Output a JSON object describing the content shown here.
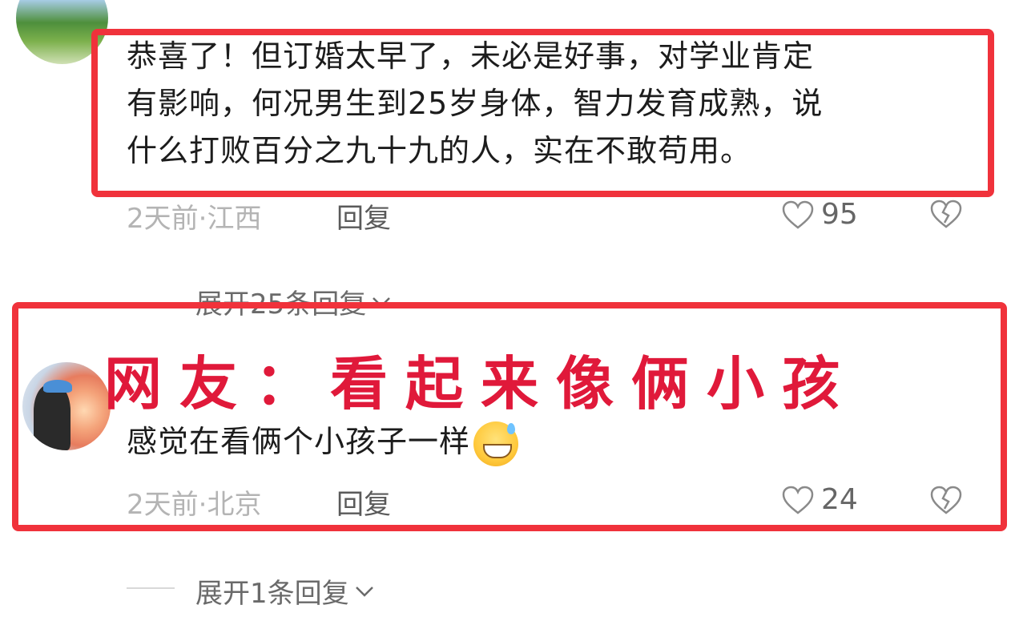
{
  "comment1": {
    "text": "恭喜了！但订婚太早了，未必是好事，对学业肯定有影响，何况男生到25岁身体，智力发育成熟，说什么打败百分之九十九的人，实在不敢苟用。",
    "lines": [
      "恭喜了！但订婚太早了，未必是好事，对学业肯定",
      "有影响，何况男生到25岁身体，智力发育成熟，说",
      "什么打败百分之九十九的人，实在不敢苟用。"
    ],
    "meta": "2天前·江西",
    "reply_label": "回复",
    "likes": "95",
    "expand_label": "展开25条回复"
  },
  "caption": "网友：看起来像俩小孩",
  "comment2": {
    "text": "感觉在看俩个小孩子一样",
    "meta": "2天前·北京",
    "reply_label": "回复",
    "likes": "24",
    "expand_label": "展开1条回复"
  },
  "icons": {
    "like": "heart-outline-icon",
    "dislike": "broken-heart-icon",
    "expand": "chevron-down-icon",
    "emoji": "grinning-sweat-emoji"
  },
  "colors": {
    "highlight": "#f0323b",
    "caption": "#e0193a",
    "meta": "#b4b4b4"
  }
}
